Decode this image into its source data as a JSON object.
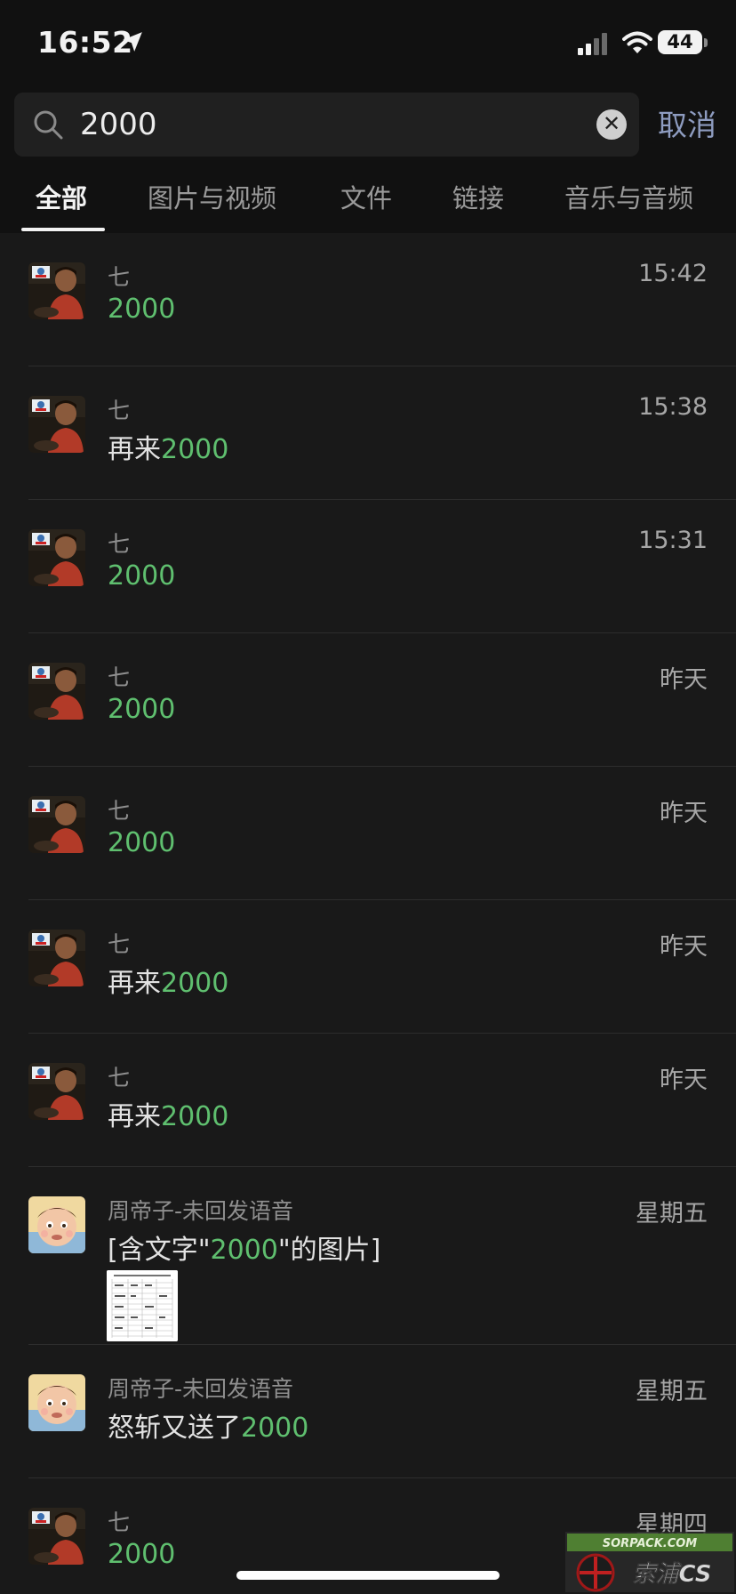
{
  "status_bar": {
    "time": "16:52",
    "battery": "44",
    "icons": [
      "location-arrow-icon",
      "cellular-signal-icon",
      "wifi-icon",
      "battery-icon"
    ]
  },
  "search": {
    "value": "2000",
    "cancel_label": "取消"
  },
  "tabs": [
    {
      "label": "全部",
      "active": true
    },
    {
      "label": "图片与视频",
      "active": false
    },
    {
      "label": "文件",
      "active": false
    },
    {
      "label": "链接",
      "active": false
    },
    {
      "label": "音乐与音频",
      "active": false
    }
  ],
  "highlight_color": "#5fbf6f",
  "results": [
    {
      "sender": "七",
      "time": "15:42",
      "prefix": "",
      "keyword": "2000",
      "suffix": "",
      "avatar": "boy-avatar"
    },
    {
      "sender": "七",
      "time": "15:38",
      "prefix": "再来",
      "keyword": "2000",
      "suffix": "",
      "avatar": "boy-avatar"
    },
    {
      "sender": "七",
      "time": "15:31",
      "prefix": "",
      "keyword": "2000",
      "suffix": "",
      "avatar": "boy-avatar"
    },
    {
      "sender": "七",
      "time": "昨天",
      "prefix": "",
      "keyword": "2000",
      "suffix": "",
      "avatar": "boy-avatar"
    },
    {
      "sender": "七",
      "time": "昨天",
      "prefix": "",
      "keyword": "2000",
      "suffix": "",
      "avatar": "boy-avatar"
    },
    {
      "sender": "七",
      "time": "昨天",
      "prefix": "再来",
      "keyword": "2000",
      "suffix": "",
      "avatar": "boy-avatar"
    },
    {
      "sender": "七",
      "time": "昨天",
      "prefix": "再来",
      "keyword": "2000",
      "suffix": "",
      "avatar": "boy-avatar"
    },
    {
      "sender": "周帝子-未回发语音",
      "time": "星期五",
      "prefix": "[含文字\"",
      "keyword": "2000",
      "suffix": "\"的图片]",
      "avatar": "cartoon-avatar",
      "has_thumbnail": true
    },
    {
      "sender": "周帝子-未回发语音",
      "time": "星期五",
      "prefix": "怒斩又送了",
      "keyword": "2000",
      "suffix": "",
      "avatar": "cartoon-avatar"
    },
    {
      "sender": "七",
      "time": "星期四",
      "prefix": "",
      "keyword": "2000",
      "suffix": "",
      "avatar": "boy-avatar"
    }
  ],
  "watermark": {
    "site": "SORPACK.COM",
    "brand": "索浦CS"
  }
}
